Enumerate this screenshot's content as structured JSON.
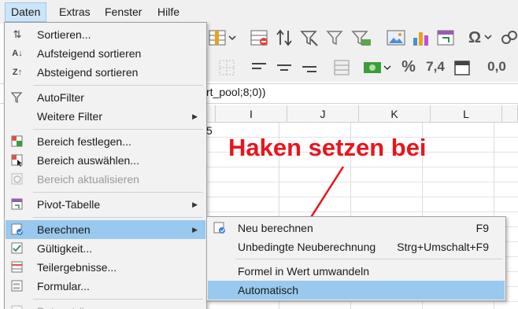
{
  "menubar": {
    "items": [
      "Daten",
      "Extras",
      "Fenster",
      "Hilfe"
    ]
  },
  "toolbar": {
    "percent_label": "%",
    "number_label": "7,4",
    "decimal_label": "0,0"
  },
  "formula_bar": {
    "text": "rt_pool;8;0))"
  },
  "columns": [
    "I",
    "J",
    "K",
    "L"
  ],
  "cell_fragment": "5",
  "annotation": {
    "text": "Haken setzen bei",
    "color": "#e8151e"
  },
  "data_menu": {
    "items": [
      {
        "label": "Sortieren...",
        "icon": "sort-icon"
      },
      {
        "label": "Aufsteigend sortieren",
        "icon": "sort-ascending-icon"
      },
      {
        "label": "Absteigend sortieren",
        "icon": "sort-descending-icon"
      },
      {
        "label": "AutoFilter",
        "icon": "autofilter-icon"
      },
      {
        "label": "Weitere Filter",
        "icon": "",
        "submenu": true
      },
      {
        "label": "Bereich festlegen...",
        "icon": "define-range-icon"
      },
      {
        "label": "Bereich auswählen...",
        "icon": "select-range-icon"
      },
      {
        "label": "Bereich aktualisieren",
        "icon": "refresh-range-icon",
        "disabled": true
      },
      {
        "label": "Pivot-Tabelle",
        "icon": "pivot-table-icon",
        "submenu": true
      },
      {
        "label": "Berechnen",
        "icon": "calculate-icon",
        "submenu": true,
        "highlighted": true
      },
      {
        "label": "Gültigkeit...",
        "icon": "validity-icon"
      },
      {
        "label": "Teilergebnisse...",
        "icon": "subtotals-icon"
      },
      {
        "label": "Formular...",
        "icon": "form-icon"
      },
      {
        "label": "Datenströme...",
        "icon": "datastreams-icon",
        "disabled": true
      }
    ]
  },
  "calc_submenu": {
    "items": [
      {
        "label": "Neu berechnen",
        "shortcut": "F9",
        "icon": "recalculate-icon"
      },
      {
        "label": "Unbedingte Neuberechnung",
        "shortcut": "Strg+Umschalt+F9"
      },
      {
        "label": "Formel in Wert umwandeln",
        "shortcut": ""
      },
      {
        "label": "Automatisch",
        "shortcut": "",
        "highlighted": true
      }
    ]
  },
  "colors": {
    "highlight": "#99c9ef",
    "menubar_active": "#cce4f7"
  }
}
